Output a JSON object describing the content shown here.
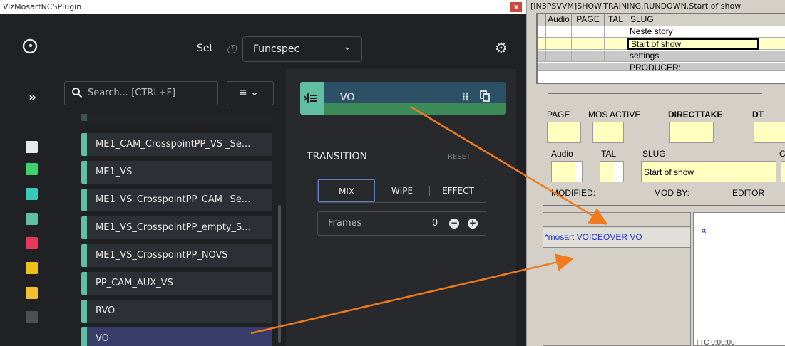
{
  "plugin": {
    "title": "VizMosartNCSPlugin",
    "close": "x",
    "set_label": "Set",
    "set_info": "ⓘ",
    "set_value": "Funcspec",
    "set_chevron": "⌄",
    "gear": "⚙",
    "expand": "»",
    "search_placeholder": "Search... [CTRL+F]",
    "view_toggle": "≡ ⌄"
  },
  "rail_icons": [
    {
      "name": "grid-icon",
      "color": "#e8e8e8"
    },
    {
      "name": "camera-icon",
      "color": "#3ed36a"
    },
    {
      "name": "film-icon",
      "color": "#39c9b8"
    },
    {
      "name": "voiceover-icon",
      "color": "#5fbfa0"
    },
    {
      "name": "record-icon",
      "color": "#e8365a"
    },
    {
      "name": "graphics-icon",
      "color": "#f0c020"
    },
    {
      "name": "phone-icon",
      "color": "#f5c030"
    },
    {
      "name": "misc-icon",
      "color": "#888888"
    }
  ],
  "templates": [
    "ME1_CAM_CrosspointPP_VS",
    "ME1_CAM_CrosspointPP_VS _Se...",
    "ME1_VS",
    "ME1_VS_CrosspointPP_CAM _Se...",
    "ME1_VS_CrosspointPP_empty_S...",
    "ME1_VS_CrosspointPP_NOVS",
    "PP_CAM_AUX_VS",
    "RVO",
    "VO"
  ],
  "editor": {
    "card_label": "VO",
    "transition_label": "TRANSITION",
    "reset_label": "RESET",
    "modes": [
      "MIX",
      "WIPE",
      "EFFECT"
    ],
    "frames_label": "Frames",
    "frames_value": "0",
    "minus": "−",
    "plus": "+"
  },
  "colors": {
    "accent_teal": "#5fbfa0",
    "arrow_orange": "#f07a1e",
    "field_yellow": "#ffffc0"
  },
  "nrcs": {
    "title": "[IN3PSVVM]SHOW.TRAINING.RUNDOWN.Start of show",
    "columns": [
      "Audio",
      "PAGE",
      "TAL",
      "SLUG"
    ],
    "rows": [
      {
        "slug": "Neste story"
      },
      {
        "slug": "Start of show"
      },
      {
        "slug": "settings"
      },
      {
        "slug": "PRODUCER:"
      }
    ],
    "form": {
      "page": "PAGE",
      "mos_active": "MOS ACTIVE",
      "directtake": "DIRECTTAKE",
      "dt": "DT",
      "audio": "Audio",
      "tal": "TAL",
      "slug": "SLUG",
      "slug_value": "Start of show",
      "slug_cut": "C",
      "modified": "MODIFIED:",
      "mod_by": "MOD BY:",
      "editor": "EDITOR"
    },
    "mos_item": "*mosart VOICEOVER VO",
    "marker": "¤",
    "ttc": "TTC 0:00:00"
  }
}
